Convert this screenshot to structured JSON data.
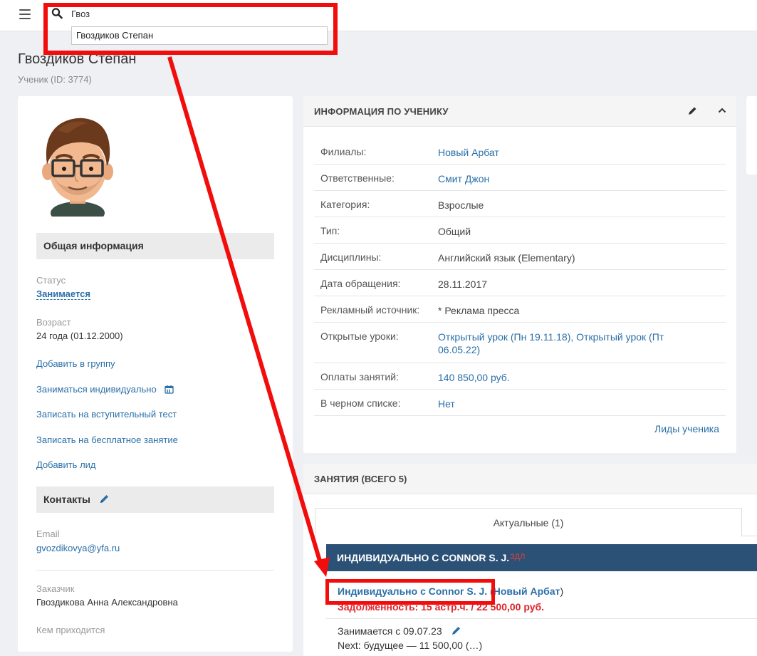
{
  "search": {
    "query": "Гвоз",
    "suggestion": "Гвоздиков Степан"
  },
  "page": {
    "title": "Гвоздиков Степан",
    "subtitle": "Ученик (ID: 3774)"
  },
  "left": {
    "general_header": "Общая информация",
    "status_label": "Статус",
    "status_value": "Занимается",
    "age_label": "Возраст",
    "age_value": "24 года (01.12.2000)",
    "actions": [
      "Добавить в группу",
      "Заниматься индивидуально",
      "Записать на вступительный тест",
      "Записать на бесплатное занятие",
      "Добавить лид"
    ],
    "contacts_header": "Контакты",
    "email_label": "Email",
    "email_value": "gvozdikovya@yfa.ru",
    "customer_label": "Заказчик",
    "customer_value": "Гвоздикова Анна Александровна",
    "relation_label": "Кем приходится"
  },
  "info": {
    "title": "ИНФОРМАЦИЯ ПО УЧЕНИКУ",
    "rows": [
      {
        "label": "Филиалы:",
        "value": "Новый Арбат"
      },
      {
        "label": "Ответственные:",
        "value": "Смит Джон"
      },
      {
        "label": "Категория:",
        "value": "Взрослые"
      },
      {
        "label": "Тип:",
        "value": "Общий"
      },
      {
        "label": "Дисциплины:",
        "value": "Английский язык (Elementary)"
      },
      {
        "label": "Дата обращения:",
        "value": "28.11.2017"
      },
      {
        "label": "Рекламный источник:",
        "value": "* Реклама пресса"
      },
      {
        "label": "Открытые уроки:",
        "value_a": "Открытый урок (Пн 19.11.18)",
        "separator": ", ",
        "value_b": "Открытый урок (Пт 06.05.22)"
      },
      {
        "label": "Оплаты занятий:",
        "value": "140 850,00 руб."
      },
      {
        "label": "В черном списке:",
        "value": "Нет"
      }
    ],
    "leads_link": "Лиды ученика"
  },
  "lessons": {
    "title": "ЗАНЯТИЯ (ВСЕГО 5)",
    "tab_active": "Актуальные (1)",
    "group_title": "ИНДИВИДУАЛЬНО С CONNOR S. J.",
    "group_tag": "ЗДЛ",
    "lesson_link": "Индивидуально с Connor S. J.",
    "lesson_prefix": " (",
    "lesson_branch": "Новый Арбат",
    "lesson_suffix": ")",
    "debt": "Задолженность: 15 астр.ч. / 22 500,00 руб.",
    "since": "Занимается с 09.07.23",
    "next_partial": "Next: будущее — 11 500,00 (…)"
  },
  "colors": {
    "accent_blue": "#2a6fa8",
    "group_bar": "#2c5176",
    "annotation_red": "#f20d0d",
    "debt_red": "#e0242a"
  },
  "icons": [
    "menu-icon",
    "search-icon",
    "calendar-icon",
    "pencil-icon",
    "chevron-up-icon"
  ]
}
